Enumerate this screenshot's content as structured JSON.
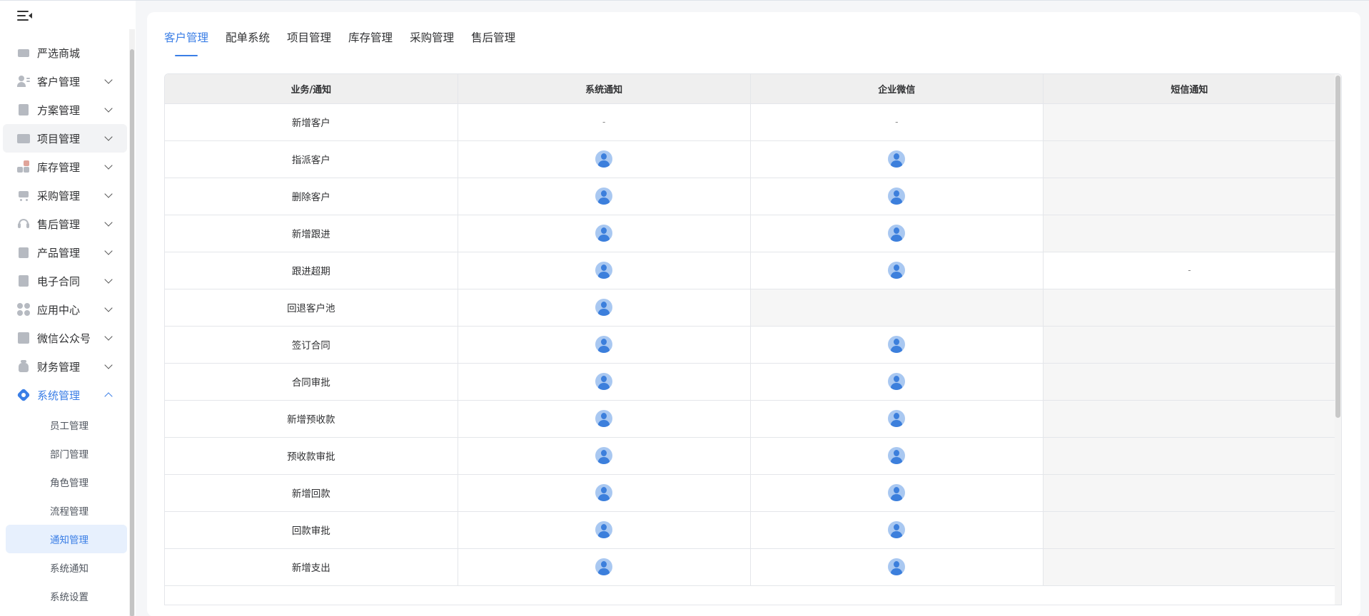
{
  "sidebar": {
    "top_partial_item": "严选商城",
    "items": [
      {
        "label": "客户管理",
        "icon": "customer-icon"
      },
      {
        "label": "方案管理",
        "icon": "plan-icon"
      },
      {
        "label": "项目管理",
        "icon": "folder-icon"
      },
      {
        "label": "库存管理",
        "icon": "inventory-icon"
      },
      {
        "label": "采购管理",
        "icon": "cart-icon"
      },
      {
        "label": "售后管理",
        "icon": "headset-icon"
      },
      {
        "label": "产品管理",
        "icon": "box-icon"
      },
      {
        "label": "电子合同",
        "icon": "contract-icon"
      },
      {
        "label": "应用中心",
        "icon": "apps-icon"
      },
      {
        "label": "微信公众号",
        "icon": "wechat-icon"
      },
      {
        "label": "财务管理",
        "icon": "finance-icon"
      },
      {
        "label": "系统管理",
        "icon": "system-icon"
      }
    ],
    "submenu": [
      {
        "label": "员工管理"
      },
      {
        "label": "部门管理"
      },
      {
        "label": "角色管理"
      },
      {
        "label": "流程管理"
      },
      {
        "label": "通知管理"
      },
      {
        "label": "系统通知"
      },
      {
        "label": "系统设置"
      }
    ]
  },
  "tabs": [
    {
      "label": "客户管理"
    },
    {
      "label": "配单系统"
    },
    {
      "label": "项目管理"
    },
    {
      "label": "库存管理"
    },
    {
      "label": "采购管理"
    },
    {
      "label": "售后管理"
    }
  ],
  "table": {
    "headers": [
      "业务/通知",
      "系统通知",
      "企业微信",
      "短信通知"
    ],
    "dash": "-",
    "rows": [
      {
        "name": "新增客户",
        "system": "dash",
        "wecom": "dash",
        "sms": "empty"
      },
      {
        "name": "指派客户",
        "system": "avatar",
        "wecom": "avatar",
        "sms": "empty"
      },
      {
        "name": "删除客户",
        "system": "avatar",
        "wecom": "avatar",
        "sms": "empty"
      },
      {
        "name": "新增跟进",
        "system": "avatar",
        "wecom": "avatar",
        "sms": "empty"
      },
      {
        "name": "跟进超期",
        "system": "avatar",
        "wecom": "avatar",
        "sms": "dash"
      },
      {
        "name": "回退客户池",
        "system": "avatar",
        "wecom": "empty",
        "sms": "empty"
      },
      {
        "name": "签订合同",
        "system": "avatar",
        "wecom": "avatar",
        "sms": "empty"
      },
      {
        "name": "合同审批",
        "system": "avatar",
        "wecom": "avatar",
        "sms": "empty"
      },
      {
        "name": "新增预收款",
        "system": "avatar",
        "wecom": "avatar",
        "sms": "empty"
      },
      {
        "name": "预收款审批",
        "system": "avatar",
        "wecom": "avatar",
        "sms": "empty"
      },
      {
        "name": "新增回款",
        "system": "avatar",
        "wecom": "avatar",
        "sms": "empty"
      },
      {
        "name": "回款审批",
        "system": "avatar",
        "wecom": "avatar",
        "sms": "empty"
      },
      {
        "name": "新增支出",
        "system": "avatar",
        "wecom": "avatar",
        "sms": "empty"
      }
    ]
  },
  "colors": {
    "accent": "#3a7ee6",
    "selected_bg": "#e7f0fd",
    "empty_cell": "#f6f6f6"
  }
}
